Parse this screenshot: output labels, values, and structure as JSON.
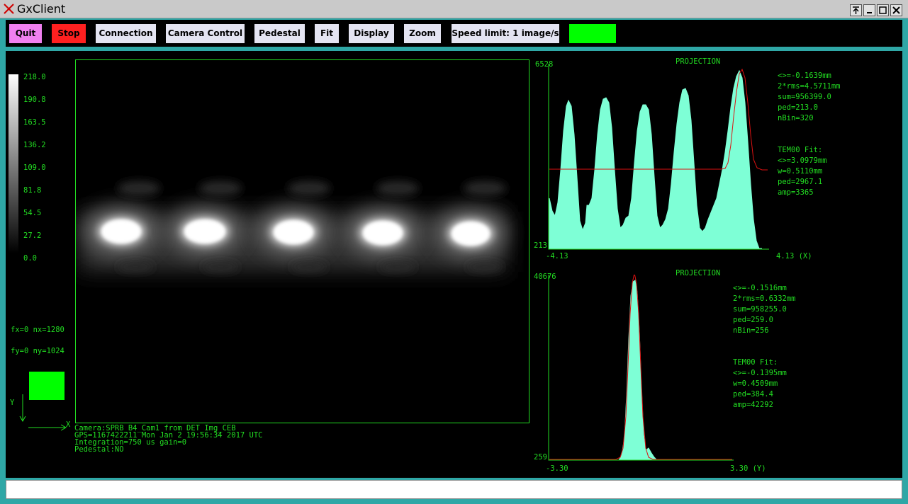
{
  "window": {
    "title": "GxClient"
  },
  "toolbar": {
    "buttons": [
      {
        "label": "Quit",
        "color": "#f080f0"
      },
      {
        "label": "Stop",
        "color": "#ff2020"
      },
      {
        "label": "Connection",
        "color": "#e4e4f2"
      },
      {
        "label": "Camera Control",
        "color": "#e4e4f2"
      },
      {
        "label": "Pedestal",
        "color": "#e4e4f2"
      },
      {
        "label": "Fit",
        "color": "#e4e4f2"
      },
      {
        "label": "Display",
        "color": "#e4e4f2"
      },
      {
        "label": "Zoom",
        "color": "#e4e4f2"
      },
      {
        "label": "Speed limit: 1 image/s",
        "color": "#e4e4f2"
      }
    ],
    "status_color": "#00ff00"
  },
  "colorbar": {
    "labels": [
      "218.0",
      "190.8",
      "163.5",
      "136.2",
      "109.0",
      "81.8",
      "54.5",
      "27.2",
      "0.0"
    ]
  },
  "image_info": {
    "fx": "fx=0 nx=1280",
    "fy": "fy=0 ny=1024",
    "status_color": "#00ff00"
  },
  "axes": {
    "x": "X",
    "y": "Y"
  },
  "camera_info": [
    "Camera:SPRB_B4_Cam1 from DET_Img_CEB",
    "GPS=1167422211 Mon Jan  2 19:56:34 2017  UTC",
    "Integration=750 us gain=0",
    "Pedestal:NO"
  ],
  "projection_x": {
    "title": "PROJECTION",
    "ymax": "6528",
    "ymin": "213",
    "xmin": "-4.13",
    "xmax": "4.13 (X)",
    "stats": [
      "<>=-0.1639mm",
      "2*rms=4.5711mm",
      "sum=956399.0",
      "ped=213.0",
      "nBin=320"
    ],
    "fit": [
      "TEM00 Fit:",
      "<>=3.0979mm",
      "w=0.5110mm",
      "ped=2967.1",
      "amp=3365"
    ]
  },
  "projection_y": {
    "title": "PROJECTION",
    "ymax": "40676",
    "ymin": "259",
    "xmin": "-3.30",
    "xmax": "3.30 (Y)",
    "stats": [
      "<>=-0.1516mm",
      "2*rms=0.6332mm",
      "sum=958255.0",
      "ped=259.0",
      "nBin=256"
    ],
    "fit": [
      "TEM00 Fit:",
      "<>=-0.1395mm",
      "w=0.4509mm",
      "ped=384.4",
      "amp=42292"
    ]
  },
  "statusbar": {
    "text": ""
  }
}
